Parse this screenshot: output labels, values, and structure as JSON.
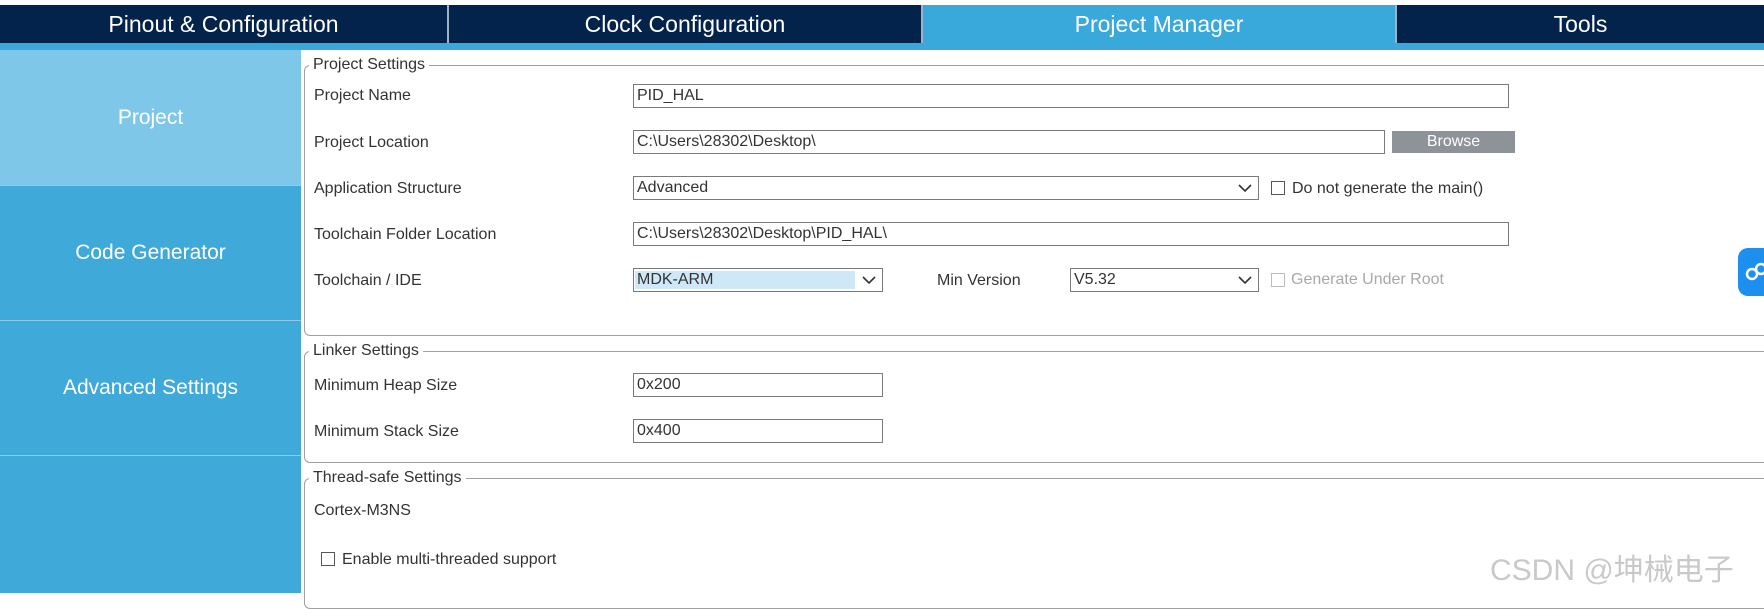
{
  "tabs": [
    {
      "label": "Pinout & Configuration"
    },
    {
      "label": "Clock Configuration"
    },
    {
      "label": "Project Manager",
      "active": true
    },
    {
      "label": "Tools"
    }
  ],
  "sidebar": {
    "items": [
      {
        "label": "Project",
        "active": true
      },
      {
        "label": "Code Generator"
      },
      {
        "label": "Advanced Settings"
      }
    ]
  },
  "project_settings": {
    "legend": "Project Settings",
    "project_name_label": "Project Name",
    "project_name_value": "PID_HAL",
    "project_location_label": "Project Location",
    "project_location_value": "C:\\Users\\28302\\Desktop\\",
    "browse_label": "Browse",
    "app_structure_label": "Application Structure",
    "app_structure_value": "Advanced",
    "no_main_label": "Do not generate the main()",
    "toolchain_folder_label": "Toolchain Folder Location",
    "toolchain_folder_value": "C:\\Users\\28302\\Desktop\\PID_HAL\\",
    "toolchain_ide_label": "Toolchain / IDE",
    "toolchain_ide_value": "MDK-ARM",
    "min_version_label": "Min Version",
    "min_version_value": "V5.32",
    "generate_under_root_label": "Generate Under Root"
  },
  "linker_settings": {
    "legend": "Linker Settings",
    "heap_label": "Minimum Heap Size",
    "heap_value": "0x200",
    "stack_label": "Minimum Stack Size",
    "stack_value": "0x400"
  },
  "thread_safe_settings": {
    "legend": "Thread-safe Settings",
    "core_label": "Cortex-M3NS",
    "multithread_label": "Enable multi-threaded support"
  },
  "watermark": "CSDN @坤械电子",
  "colors": {
    "tab_dark": "#03234b",
    "tab_active": "#39a9dc",
    "sidebar": "#3fa9d9",
    "sidebar_active": "#7ec7e9",
    "browse_button": "#8e9299",
    "floating_button": "#1d8fef"
  },
  "icons": [
    "chevron-down-icon",
    "link-icon",
    "checkbox-icon"
  ]
}
